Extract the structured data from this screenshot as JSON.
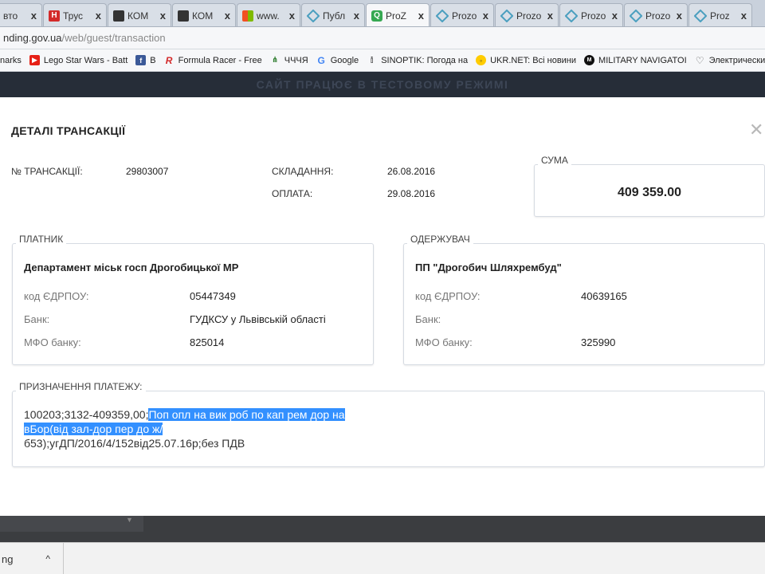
{
  "browser": {
    "tabs": [
      {
        "title": "вто",
        "icon": "none"
      },
      {
        "title": "Трус",
        "icon": "red"
      },
      {
        "title": "КОМ",
        "icon": "dark"
      },
      {
        "title": "КОМ",
        "icon": "dark"
      },
      {
        "title": "www.",
        "icon": "grid"
      },
      {
        "title": "Публ",
        "icon": "diamond"
      },
      {
        "title": "ProZ",
        "icon": "q"
      },
      {
        "title": "Prozo",
        "icon": "diamond"
      },
      {
        "title": "Prozo",
        "icon": "diamond"
      },
      {
        "title": "Prozo",
        "icon": "diamond"
      },
      {
        "title": "Prozo",
        "icon": "diamond"
      },
      {
        "title": "Proz",
        "icon": "diamond"
      }
    ],
    "close_glyph": "x",
    "address": {
      "domain": "nding.gov.ua",
      "path": "/web/guest/transaction"
    },
    "bookmarks": [
      {
        "label": "narks",
        "icon": ""
      },
      {
        "label": "Lego Star Wars - Batt",
        "icon": "youtube-icon"
      },
      {
        "label": "B",
        "icon": "facebook-icon"
      },
      {
        "label": "Formula Racer - Free",
        "icon": "formula-racer-icon"
      },
      {
        "label": "ЧЧЧЯ",
        "icon": "chchchya-icon"
      },
      {
        "label": "Google",
        "icon": "google-icon"
      },
      {
        "label": "SINOPTIK: Погода на",
        "icon": "sinoptik-icon"
      },
      {
        "label": "UKR.NET: Всі новини",
        "icon": "ukrnet-icon"
      },
      {
        "label": "MILITARY NAVIGATOI",
        "icon": "military-icon"
      },
      {
        "label": "Электрические",
        "icon": "tooth-icon"
      }
    ]
  },
  "banner": {
    "text": "САЙТ ПРАЦЮЄ В ТЕСТОВОМУ РЕЖИМІ"
  },
  "modal": {
    "title": "ДЕТАЛІ ТРАНСАКЦІЇ",
    "close_glyph": "✕",
    "transaction": {
      "number_label": "№ ТРАНСАКЦІЇ:",
      "number_value": "29803007",
      "created_label": "СКЛАДАННЯ:",
      "created_value": "26.08.2016",
      "paid_label": "ОПЛАТА:",
      "paid_value": "29.08.2016"
    },
    "sum": {
      "legend": "СУМА",
      "value": "409 359.00"
    },
    "payer": {
      "legend": "ПЛАТНИК",
      "name": "Департамент міськ госп Дрогобицької МР",
      "edrpou_label": "код ЄДРПОУ:",
      "edrpou_value": "05447349",
      "bank_label": "Банк:",
      "bank_value": "ГУДКСУ у Львівській області",
      "mfo_label": "МФО банку:",
      "mfo_value": "825014"
    },
    "receiver": {
      "legend": "ОДЕРЖУВАЧ",
      "name": "ПП \"Дрогобич Шляхрембуд\"",
      "edrpou_label": "код ЄДРПОУ:",
      "edrpou_value": "40639165",
      "bank_label": "Банк:",
      "bank_value": "",
      "mfo_label": "МФО банку:",
      "mfo_value": "325990"
    },
    "purpose": {
      "legend": "ПРИЗНАЧЕННЯ ПЛАТЕЖУ:",
      "text_plain_1": "100203;3132-409359,00;",
      "text_selected_1": "Поп опл на вик роб по кап рем дор на",
      "text_selected_2": "вБор(від зал-дор пер до ж/",
      "text_plain_2": "б53);угДП/2016/4/152від25.07.16р;без ПДВ"
    }
  },
  "downloads": {
    "item_label": "ng",
    "caret": "^"
  }
}
